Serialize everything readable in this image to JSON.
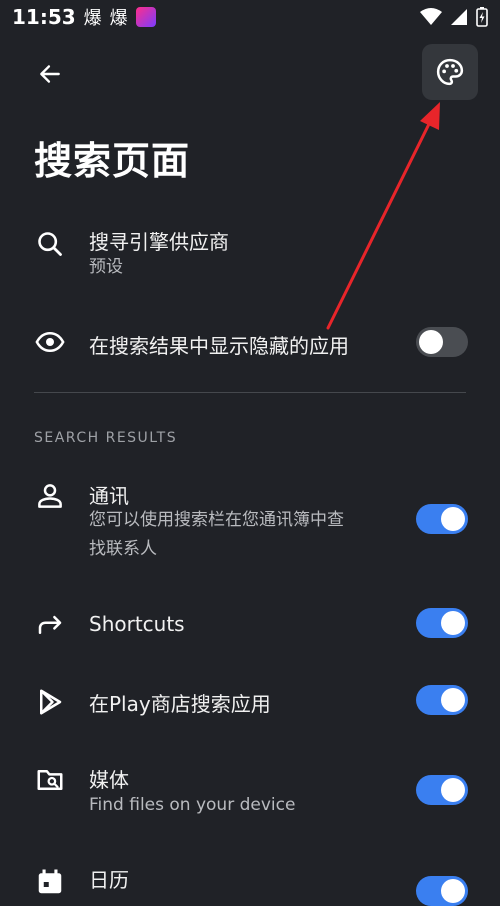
{
  "status_bar": {
    "time": "11:53",
    "glyph1": "爆",
    "glyph2": "爆"
  },
  "page": {
    "title": "搜索页面"
  },
  "settings": {
    "search_engine": {
      "title": "搜寻引擎供应商",
      "subtitle": "预设",
      "icon": "search-icon"
    },
    "show_hidden": {
      "title": "在搜索结果中显示隐藏的应用",
      "enabled": false,
      "icon": "eye-icon"
    }
  },
  "section": {
    "header": "SEARCH RESULTS"
  },
  "results": [
    {
      "title": "通讯",
      "subtitle_line1": "您可以使用搜索栏在您通讯簿中查",
      "subtitle_line2": "找联系人",
      "enabled": true,
      "icon": "person-icon"
    },
    {
      "title": "Shortcuts",
      "enabled": true,
      "icon": "forward-arrow-icon"
    },
    {
      "title": "在Play商店搜索应用",
      "enabled": true,
      "icon": "play-store-icon"
    },
    {
      "title": "媒体",
      "subtitle": "Find files on your device",
      "enabled": true,
      "icon": "folder-search-icon"
    },
    {
      "title": "日历",
      "enabled": true,
      "icon": "calendar-icon"
    }
  ],
  "colors": {
    "background": "#202227",
    "accent": "#3a7ff0",
    "annotation_arrow": "#e8252a"
  }
}
